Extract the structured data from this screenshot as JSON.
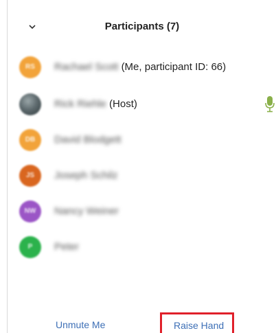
{
  "header": {
    "title": "Participants",
    "count_label": "(7)",
    "collapse_icon": "chevron-down-icon"
  },
  "participants": [
    {
      "name": "Rachael Scott",
      "suffix": "(Me, participant ID: 66)",
      "initials": "RS",
      "avatar_color": "#f2a33a",
      "mic": false
    },
    {
      "name": "Rick Riehle",
      "suffix": "(Host)",
      "initials": "",
      "avatar_color": "#5f6b6f",
      "mic": true
    },
    {
      "name": "David Blodgett",
      "suffix": "",
      "initials": "DB",
      "avatar_color": "#f2a33a",
      "mic": false
    },
    {
      "name": "Joseph Schilz",
      "suffix": "",
      "initials": "JS",
      "avatar_color": "#d9661f",
      "mic": false
    },
    {
      "name": "Nancy Weiner",
      "suffix": "",
      "initials": "NW",
      "avatar_color": "#9b55c6",
      "mic": false
    },
    {
      "name": "Peter",
      "suffix": "",
      "initials": "P",
      "avatar_color": "#2bb24c",
      "mic": false
    }
  ],
  "footer": {
    "unmute_label": "Unmute Me",
    "raise_hand_label": "Raise Hand",
    "highlight_color": "#e0202a",
    "link_color": "#3d6fb6"
  },
  "mic_icon": "microphone-icon",
  "mic_color": "#8ab04a"
}
